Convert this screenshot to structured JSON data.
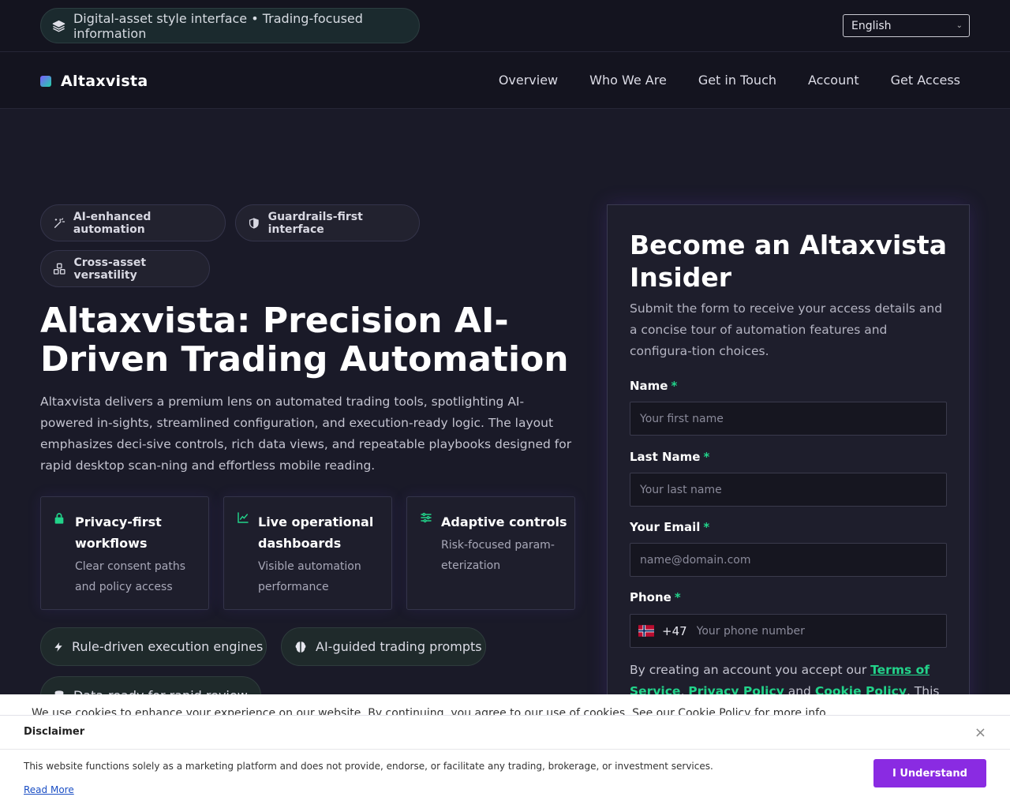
{
  "topbar": {
    "pill_text": "Digital-asset style interface • Trading-focused information",
    "language": "English"
  },
  "nav": {
    "brand": "Altaxvista",
    "links": [
      "Overview",
      "Who We Are",
      "Get in Touch",
      "Account",
      "Get Access"
    ]
  },
  "hero": {
    "badges": [
      "AI-enhanced automation",
      "Guardrails-first interface",
      "Cross-asset versatility"
    ],
    "title": "Altaxvista: Precision AI-Driven Trading Automation",
    "description": "Altaxvista delivers a premium lens on automated trading tools, spotlighting AI-powered in-sights, streamlined configuration, and execution-ready logic. The layout emphasizes deci-sive controls, rich data views, and repeatable playbooks designed for rapid desktop scan-ning and effortless mobile reading.",
    "features": [
      {
        "title": "Privacy-first workflows",
        "desc": "Clear consent paths and policy access",
        "icon": "lock-icon"
      },
      {
        "title": "Live operational dashboards",
        "desc": "Visible automation performance",
        "icon": "chart-line-icon"
      },
      {
        "title": "Adaptive controls",
        "desc": "Risk-focused param-eterization",
        "icon": "sliders-icon"
      }
    ],
    "pills": [
      "Rule-driven execution engines",
      "AI-guided trading prompts",
      "Data-ready for rapid review"
    ]
  },
  "form": {
    "title": "Become an Altaxvista Insider",
    "subtitle": "Submit the form to receive your access details and a concise tour of automation features and configura-tion choices.",
    "fields": {
      "first_name": {
        "label": "Name",
        "placeholder": "Your first name"
      },
      "last_name": {
        "label": "Last Name",
        "placeholder": "Your last name"
      },
      "email": {
        "label": "Your Email",
        "placeholder": "name@domain.com"
      },
      "phone": {
        "label": "Phone",
        "dial_code": "+47",
        "placeholder": "Your phone number"
      }
    },
    "required_mark": "*",
    "terms_prefix": "By creating an account you accept our ",
    "terms_link": "Terms of Service",
    "sep1": ", ",
    "privacy_link": "Privacy Policy",
    "sep2": " and ",
    "cookie_link": "Cookie Policy",
    "terms_suffix": ". This web-"
  },
  "cookie_strip": {
    "text": "We use cookies to enhance your experience on our website. By continuing, you agree to our use of cookies. See our Cookie Policy for more info."
  },
  "disclaimer": {
    "title": "Disclaimer",
    "text": "This website functions solely as a marketing platform and does not provide, endorse, or facilitate any trading, brokerage, or investment services.",
    "read_more": "Read More",
    "button": "I Understand",
    "close": "×"
  },
  "colors": {
    "accent_green": "#22d38a",
    "accent_purple": "#8a2be2",
    "background": "#1a1a28"
  }
}
